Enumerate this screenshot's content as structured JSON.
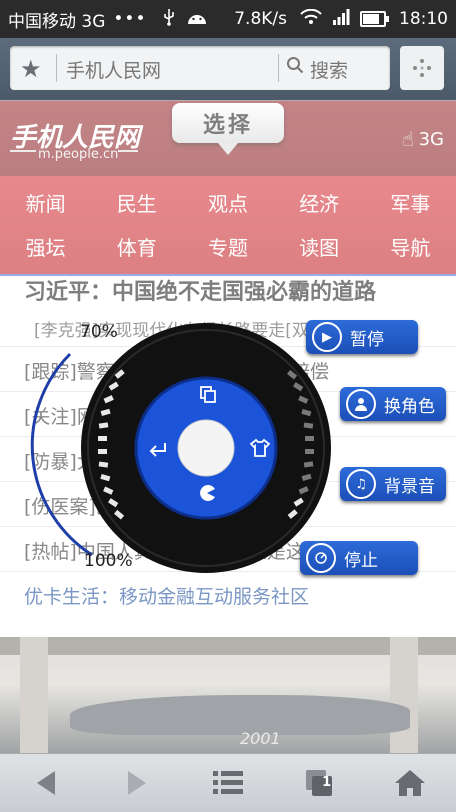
{
  "status_bar": {
    "carrier": "中国移动 3G",
    "dots": "•••",
    "speed": "7.8K/s",
    "time": "18:10"
  },
  "browser": {
    "address_text": "手机人民网",
    "search_label": "搜索"
  },
  "site": {
    "logo_cn": "手机人民网",
    "logo_en": "m.people.cn",
    "network": "3G",
    "choose_label": "选择",
    "nav_items": [
      "新闻",
      "民生",
      "观点",
      "经济",
      "军事",
      "强坛",
      "体育",
      "专题",
      "读图",
      "导航"
    ],
    "headline": "习近平：中国绝不走国强必霸的道路",
    "subline": "[李克强]实现现代化有很长路要走[双语版]",
    "news_rows": [
      "[跟踪]警察打人致死判赔偿70万赔偿",
      "[关注]网曝温州城管打人手段残忍",
      "[防暴]大连加强反恐防暴工作体系",
      "[伤医案]医闹事件频发 医生替罪",
      "[热帖]中国人真厉害：日本人是这样看"
    ],
    "promo_link": "优卡生活：移动金融互动服务社区",
    "photo_caption": "2001"
  },
  "player": {
    "progress_start_label": "70%",
    "progress_end_label": "100%",
    "buttons": {
      "pause": "暂停",
      "switch_character": "换角色",
      "background_music": "背景音",
      "stop": "停止"
    }
  },
  "bottom_bar": {
    "tab_count": "1"
  },
  "colors": {
    "nav_red": "#d8343a",
    "player_blue": "#1c4fb8",
    "link_blue": "#1a4a9c"
  }
}
